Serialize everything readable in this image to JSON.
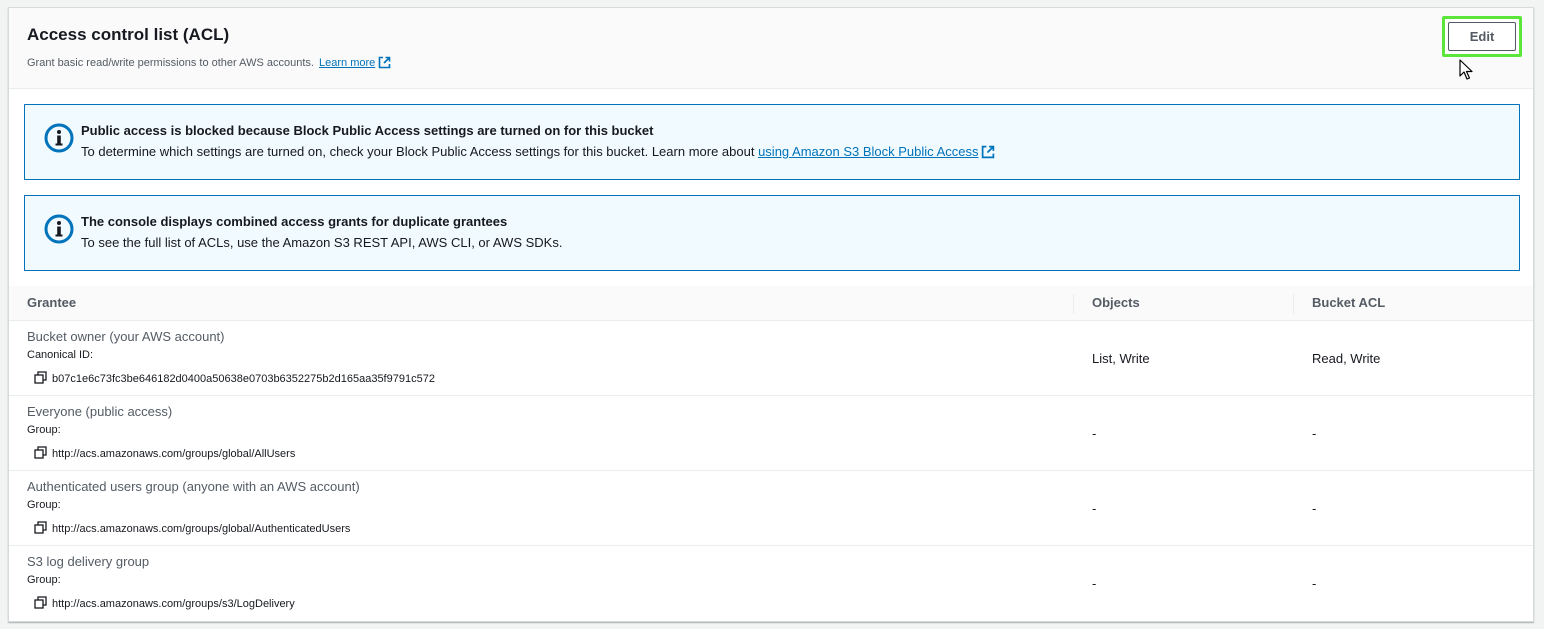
{
  "header": {
    "title": "Access control list (ACL)",
    "description": "Grant basic read/write permissions to other AWS accounts.",
    "learn_more": "Learn more",
    "edit_label": "Edit"
  },
  "alerts": [
    {
      "title": "Public access is blocked because Block Public Access settings are turned on for this bucket",
      "text": "To determine which settings are turned on, check your Block Public Access settings for this bucket. Learn more about ",
      "link": "using Amazon S3 Block Public Access"
    },
    {
      "title": "The console displays combined access grants for duplicate grantees",
      "text": "To see the full list of ACLs, use the Amazon S3 REST API, AWS CLI, or AWS SDKs."
    }
  ],
  "table": {
    "columns": [
      "Grantee",
      "Objects",
      "Bucket ACL"
    ],
    "rows": [
      {
        "name": "Bucket owner (your AWS account)",
        "id_label": "Canonical ID:",
        "id_value": "b07c1e6c73fc3be646182d0400a50638e0703b6352275b2d165aa35f9791c572",
        "objects": "List, Write",
        "bucket_acl": "Read, Write"
      },
      {
        "name": "Everyone (public access)",
        "id_label": "Group:",
        "id_value": "http://acs.amazonaws.com/groups/global/AllUsers",
        "objects": "-",
        "bucket_acl": "-"
      },
      {
        "name": "Authenticated users group (anyone with an AWS account)",
        "id_label": "Group:",
        "id_value": "http://acs.amazonaws.com/groups/global/AuthenticatedUsers",
        "objects": "-",
        "bucket_acl": "-"
      },
      {
        "name": "S3 log delivery group",
        "id_label": "Group:",
        "id_value": "http://acs.amazonaws.com/groups/s3/LogDelivery",
        "objects": "-",
        "bucket_acl": "-"
      }
    ]
  },
  "icons": {
    "info": "info-icon",
    "external": "external-link-icon",
    "copy": "copy-icon",
    "cursor": "mouse-pointer-icon"
  },
  "colors": {
    "link": "#0073bb",
    "alert_border": "#0073bb",
    "alert_bg": "#f1faff",
    "highlight": "#5ce63a"
  }
}
